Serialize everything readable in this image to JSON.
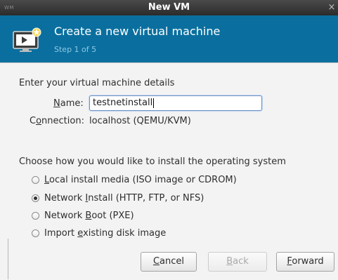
{
  "window": {
    "title": "New VM",
    "menu_glyph": "WM",
    "close_glyph": "×"
  },
  "banner": {
    "title": "Create a new virtual machine",
    "step": "Step 1 of 5",
    "icon": "new-vm-monitor-icon"
  },
  "details": {
    "heading": "Enter your virtual machine details",
    "name_label_pre": "",
    "name_label_key": "N",
    "name_label_post": "ame:",
    "name_value": "testnetinstall",
    "connection_label_pre": "C",
    "connection_label_key": "o",
    "connection_label_post": "nnection:",
    "connection_value": "localhost (QEMU/KVM)"
  },
  "install": {
    "heading": "Choose how you would like to install the operating system",
    "options": [
      {
        "pre": "",
        "key": "L",
        "post": "ocal install media (ISO image or CDROM)",
        "checked": false
      },
      {
        "pre": "Network ",
        "key": "I",
        "post": "nstall (HTTP, FTP, or NFS)",
        "checked": true
      },
      {
        "pre": "Network ",
        "key": "B",
        "post": "oot (PXE)",
        "checked": false
      },
      {
        "pre": "Import ",
        "key": "e",
        "post": "xisting disk image",
        "checked": false
      }
    ]
  },
  "buttons": {
    "cancel": {
      "key": "C",
      "post": "ancel"
    },
    "back": {
      "key": "B",
      "post": "ack"
    },
    "forward": {
      "key": "F",
      "post": "orward"
    }
  },
  "colors": {
    "banner": "#0a6f9f",
    "banner_step": "#8fc8e4",
    "titlebar": "#2b2b2b",
    "content_bg": "#f3f3f3"
  }
}
